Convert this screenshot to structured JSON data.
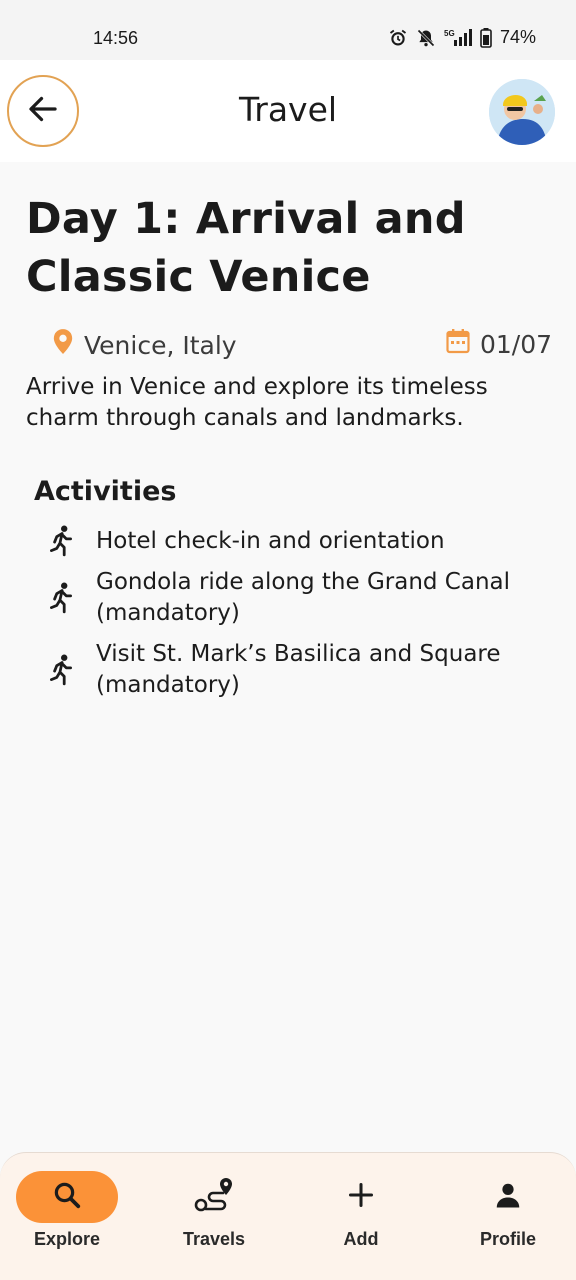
{
  "status_bar": {
    "time": "14:56",
    "battery": "74%",
    "icons": [
      "alarm-icon",
      "mute-icon",
      "signal-5g-icon",
      "battery-icon"
    ]
  },
  "header": {
    "title": "Travel",
    "back_icon": "arrow-left-icon",
    "accent": "#e2a253"
  },
  "day": {
    "title": "Day 1: Arrival and Classic Venice",
    "location": "Venice, Italy",
    "date": "01/07",
    "description": "Arrive in Venice and explore its timeless charm through canals and landmarks.",
    "icon_color": "#f29a47"
  },
  "activities": {
    "heading": "Activities",
    "items": [
      {
        "label": "Hotel check-in and orientation"
      },
      {
        "label": "Gondola ride along the Grand Canal (mandatory)"
      },
      {
        "label": "Visit St. Mark’s Basilica and Square (mandatory)"
      }
    ]
  },
  "bottom_nav": {
    "active_color": "#fb9238",
    "items": [
      {
        "label": "Explore",
        "icon": "search-icon",
        "active": true
      },
      {
        "label": "Travels",
        "icon": "route-icon",
        "active": false
      },
      {
        "label": "Add",
        "icon": "plus-icon",
        "active": false
      },
      {
        "label": "Profile",
        "icon": "person-icon",
        "active": false
      }
    ]
  }
}
